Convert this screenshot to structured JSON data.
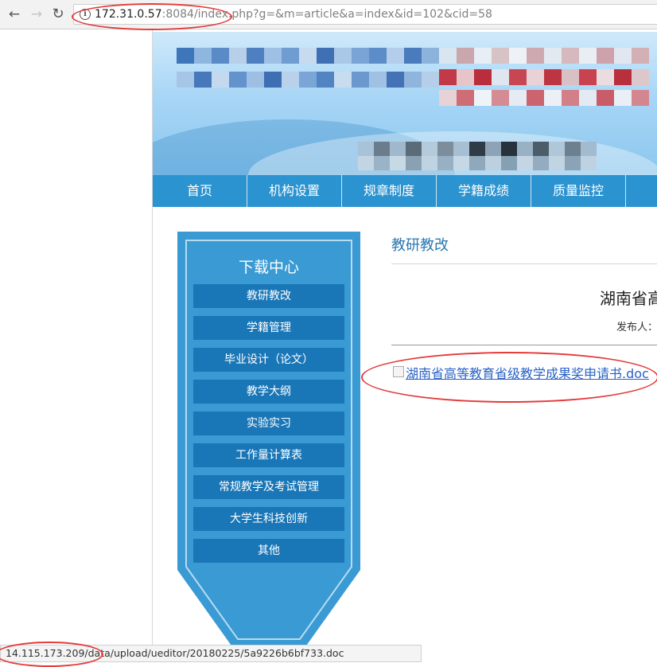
{
  "browser": {
    "url_host": "172.31.0.57",
    "url_rest": ":8084/index.php?g=&m=article&a=index&id=102&cid=58",
    "back_icon": "←",
    "forward_icon": "→",
    "reload_icon": "↻",
    "info_icon": "i"
  },
  "nav": {
    "items": [
      "首页",
      "机构设置",
      "规章制度",
      "学籍成绩",
      "质量监控",
      "教"
    ]
  },
  "sidebar": {
    "title": "下载中心",
    "items": [
      "教研教改",
      "学籍管理",
      "毕业设计（论文）",
      "教学大纲",
      "实验实习",
      "工作量计算表",
      "常规教学及考试管理",
      "大学生科技创新",
      "其他"
    ]
  },
  "content": {
    "breadcrumb": "教研教改",
    "article_title": "湖南省高",
    "article_meta": "发布人：",
    "attachment_link": "湖南省高等教育省级教学成果奖申请书.doc"
  },
  "status_bar": {
    "text": "14.115.173.209/data/upload/ueditor/20180225/5a9226b6bf733.doc"
  },
  "colors": {
    "nav_blue": "#2b93cf",
    "sidebar_blue": "#3a9ad3",
    "sidebar_item": "#1a77b7",
    "annotation_red": "#e43b3b",
    "link": "#2a62c4"
  }
}
